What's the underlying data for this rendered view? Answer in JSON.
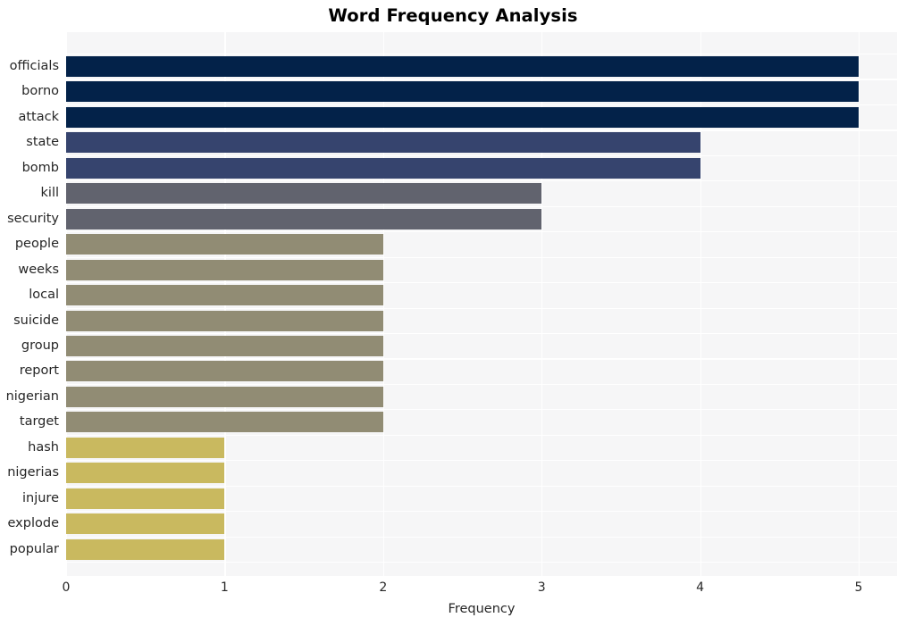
{
  "chart_data": {
    "type": "bar",
    "orientation": "horizontal",
    "title": "Word Frequency Analysis",
    "xlabel": "Frequency",
    "ylabel": "",
    "xlim": [
      0,
      5
    ],
    "xticks": [
      "0",
      "1",
      "2",
      "3",
      "4",
      "5"
    ],
    "grid": true,
    "legend": "none",
    "categories": [
      "officials",
      "borno",
      "attack",
      "state",
      "bomb",
      "kill",
      "security",
      "people",
      "weeks",
      "local",
      "suicide",
      "group",
      "report",
      "nigerian",
      "target",
      "hash",
      "nigerias",
      "injure",
      "explode",
      "popular"
    ],
    "values": [
      5,
      5,
      5,
      4,
      4,
      3,
      3,
      2,
      2,
      2,
      2,
      2,
      2,
      2,
      2,
      1,
      1,
      1,
      1,
      1
    ],
    "bar_colors": [
      "#032249",
      "#032249",
      "#032249",
      "#36446e",
      "#36446e",
      "#61636e",
      "#61636e",
      "#918c74",
      "#918c74",
      "#918c74",
      "#918c74",
      "#918c74",
      "#918c74",
      "#918c74",
      "#918c74",
      "#c9b95f",
      "#c9b95f",
      "#c9b95f",
      "#c9b95f",
      "#c9b95f"
    ],
    "plot_background": "#f6f6f7",
    "gridline_color": "#ffffff",
    "figure_background": "#ffffff"
  }
}
